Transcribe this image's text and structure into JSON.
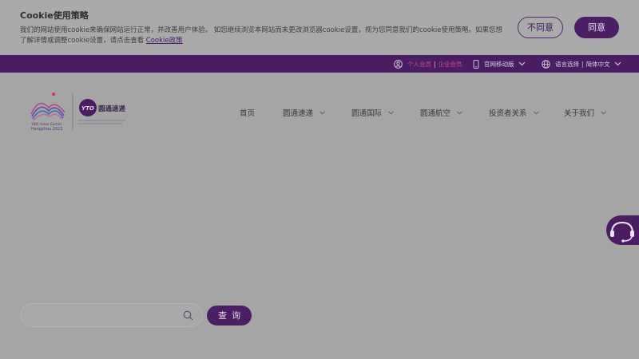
{
  "cookie": {
    "title": "Cookie使用策略",
    "text": "我们的网站使用cookie来确保网站运行正常，并改善用户体验。 如您继续浏览本网站而未更改浏览器cookie设置，视为您同意我们的cookie使用策略。如果您想了解详情或调整cookie设置，请点击查看 ",
    "link": "Cookie政策",
    "disagree_label": "不同意",
    "agree_label": "同意"
  },
  "topbar": {
    "personal": "个人会员",
    "separator": "|",
    "enterprise": "企业会员",
    "mobile": "官网移动版",
    "language_prefix": "语言选择",
    "language_value": "简体中文"
  },
  "logo": {
    "games_line1": "19th Asian Games",
    "games_line2": "Hangzhou 2022",
    "brand_mark": "YTO",
    "brand_name": "圆通速递"
  },
  "nav": {
    "items": [
      {
        "label": "首页",
        "dropdown": false
      },
      {
        "label": "圆通速递",
        "dropdown": true
      },
      {
        "label": "圆通国际",
        "dropdown": true
      },
      {
        "label": "圆通航空",
        "dropdown": true
      },
      {
        "label": "投资者关系",
        "dropdown": true
      },
      {
        "label": "关于我们",
        "dropdown": true
      }
    ]
  },
  "search": {
    "placeholder": "",
    "button_label": "查询"
  },
  "colors": {
    "brand_purple": "#4a1d62",
    "overlay_gray": "#a5a5a5",
    "accent_pink": "#c94a8a"
  }
}
